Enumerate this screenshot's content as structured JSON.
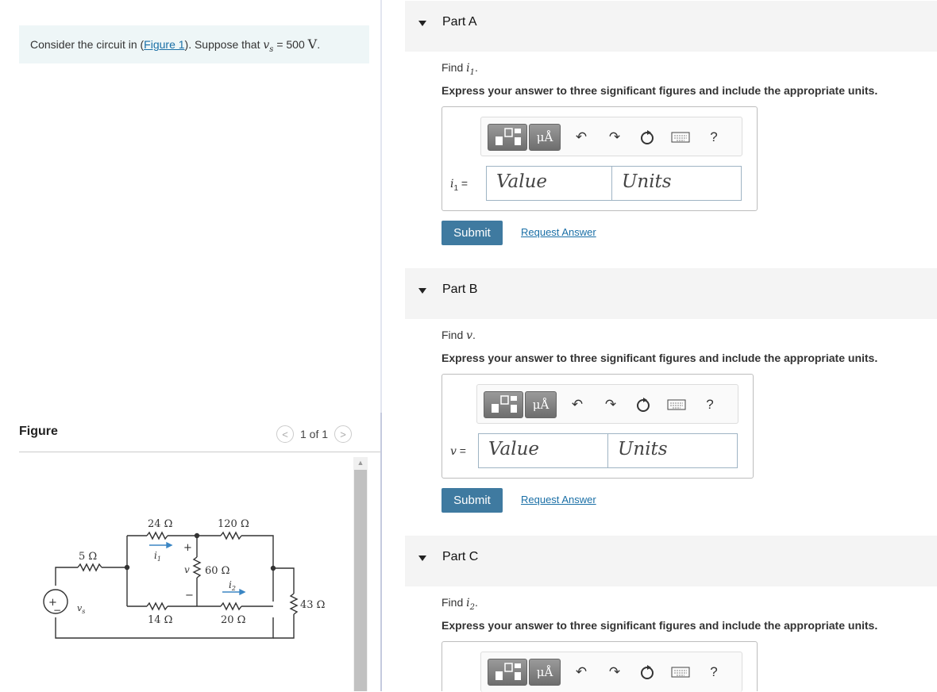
{
  "intro": {
    "prefix": "Consider the circuit in (",
    "link": "Figure 1",
    "middle": "). Suppose that ",
    "var": "v",
    "sub": "s",
    "equals": " = 500 ",
    "unit": "V",
    "suffix": "."
  },
  "figure": {
    "heading": "Figure",
    "pager": "1 of 1",
    "prev": "<",
    "next": ">",
    "circuit_labels": {
      "r5": "5 Ω",
      "r24": "24 Ω",
      "r120": "120 Ω",
      "r60": "60 Ω",
      "r14": "14 Ω",
      "r20": "20 Ω",
      "r43": "43 Ω",
      "vs": "v",
      "vs_sub": "s",
      "i1": "i",
      "i1_sub": "1",
      "i2": "i",
      "i2_sub": "2",
      "v": "v",
      "plus": "+",
      "minus": "−"
    }
  },
  "parts": [
    {
      "label": "Part A",
      "find_prefix": "Find ",
      "find_var": "i",
      "find_sub": "1",
      "find_suffix": ".",
      "instructions": "Express your answer to three significant figures and include the appropriate units.",
      "eq_var": "i",
      "eq_sub": "1",
      "eq_sign": " =",
      "value_placeholder": "Value",
      "units_placeholder": "Units",
      "submit": "Submit",
      "request": "Request Answer"
    },
    {
      "label": "Part B",
      "find_prefix": "Find ",
      "find_var": "v",
      "find_sub": "",
      "find_suffix": ".",
      "instructions": "Express your answer to three significant figures and include the appropriate units.",
      "eq_var": "v",
      "eq_sub": "",
      "eq_sign": " =",
      "value_placeholder": "Value",
      "units_placeholder": "Units",
      "submit": "Submit",
      "request": "Request Answer"
    },
    {
      "label": "Part C",
      "find_prefix": "Find ",
      "find_var": "i",
      "find_sub": "2",
      "find_suffix": ".",
      "instructions": "Express your answer to three significant figures and include the appropriate units."
    }
  ],
  "toolbar": {
    "micro_label": "μÅ",
    "help": "?"
  }
}
